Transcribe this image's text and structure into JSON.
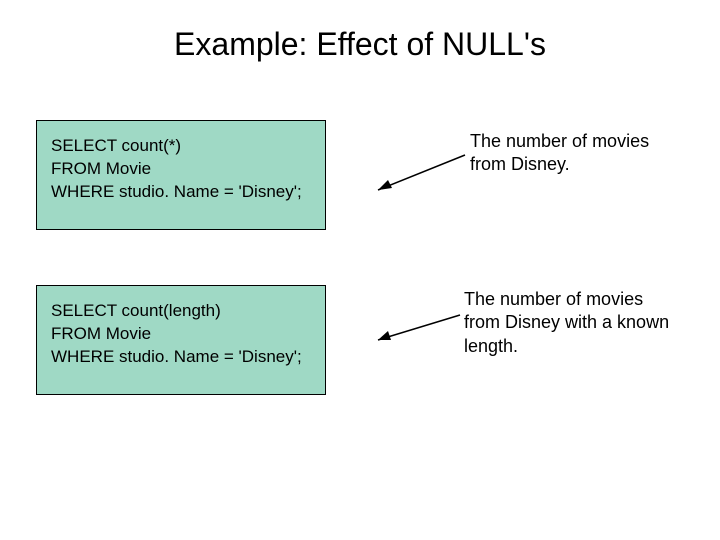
{
  "title": "Example: Effect of NULL's",
  "box1": {
    "line1": "SELECT count(*)",
    "line2": "FROM Movie",
    "line3": "WHERE studio. Name = 'Disney';"
  },
  "box2": {
    "line1": "SELECT count(length)",
    "line2": "FROM Movie",
    "line3": "WHERE studio. Name = 'Disney';"
  },
  "caption1": "The number of movies from Disney.",
  "caption2": "The number of movies from Disney with a known length."
}
